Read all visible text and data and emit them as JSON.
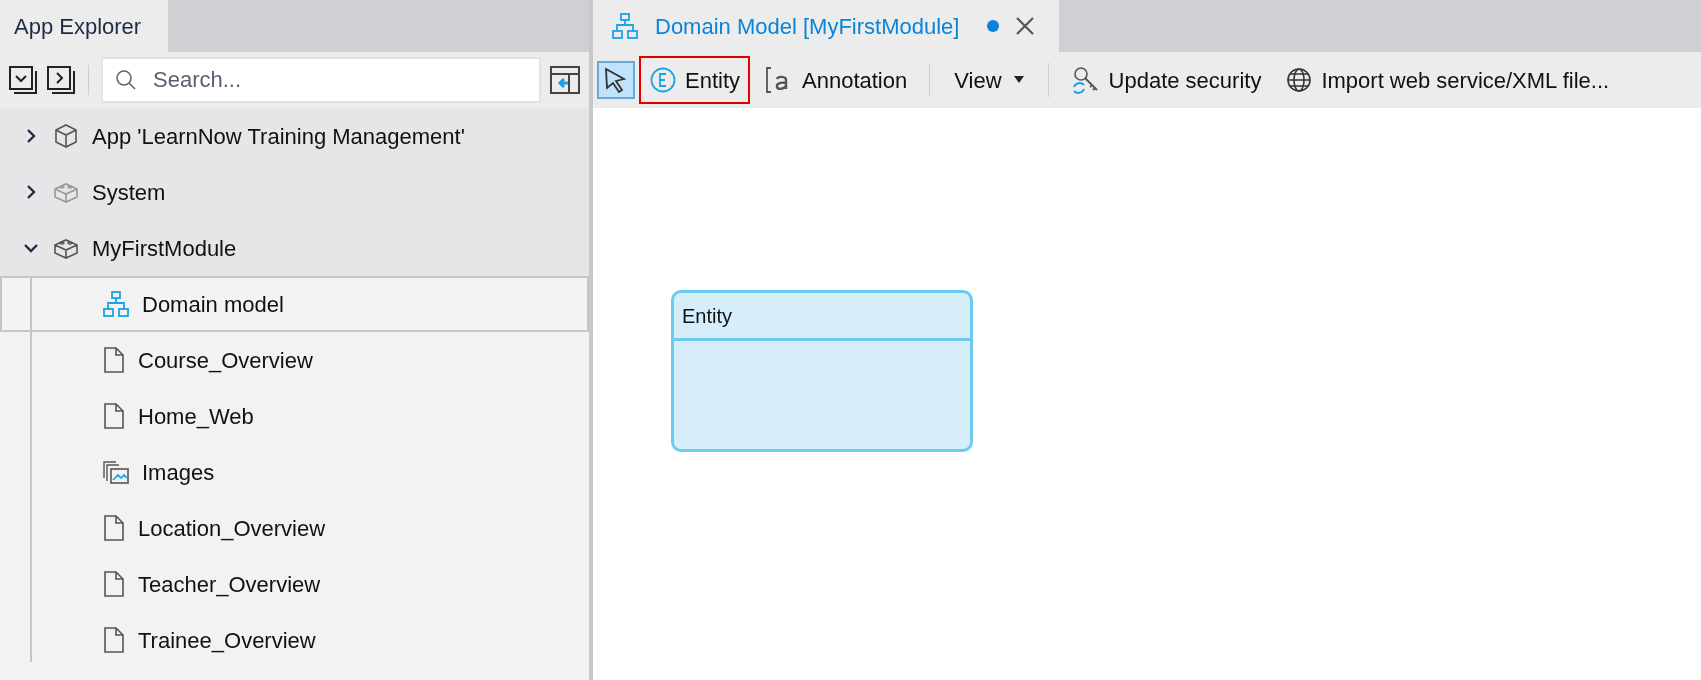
{
  "explorer": {
    "title": "App Explorer",
    "search": {
      "placeholder": "Search..."
    },
    "tree": [
      {
        "label": "App 'LearnNow Training Management'",
        "kind": "app",
        "expanded": false,
        "selected": false
      },
      {
        "label": "System",
        "kind": "system-module",
        "expanded": false,
        "selected": false
      },
      {
        "label": "MyFirstModule",
        "kind": "module",
        "expanded": true,
        "selected": false,
        "children": [
          {
            "label": "Domain model",
            "kind": "domain-model",
            "selected": true
          },
          {
            "label": "Course_Overview",
            "kind": "page",
            "selected": false
          },
          {
            "label": "Home_Web",
            "kind": "page",
            "selected": false
          },
          {
            "label": "Images",
            "kind": "images",
            "selected": false
          },
          {
            "label": "Location_Overview",
            "kind": "page",
            "selected": false
          },
          {
            "label": "Teacher_Overview",
            "kind": "page",
            "selected": false
          },
          {
            "label": "Trainee_Overview",
            "kind": "page",
            "selected": false
          }
        ]
      }
    ]
  },
  "editor": {
    "tab": {
      "title": "Domain Model [MyFirstModule]",
      "unsaved": true
    },
    "toolbar": [
      {
        "kind": "pointer",
        "selected": true
      },
      {
        "kind": "entity",
        "label": "Entity",
        "highlighted": true
      },
      {
        "kind": "annotation",
        "label": "Annotation",
        "highlighted": false
      },
      {
        "kind": "separator"
      },
      {
        "kind": "dropdown",
        "label": "View"
      },
      {
        "kind": "separator"
      },
      {
        "kind": "security",
        "label": "Update security",
        "highlighted": false
      },
      {
        "kind": "webservice",
        "label": "Import web service/XML file...",
        "highlighted": false
      }
    ],
    "canvas": {
      "entities": [
        {
          "name": "Entity"
        }
      ]
    }
  }
}
